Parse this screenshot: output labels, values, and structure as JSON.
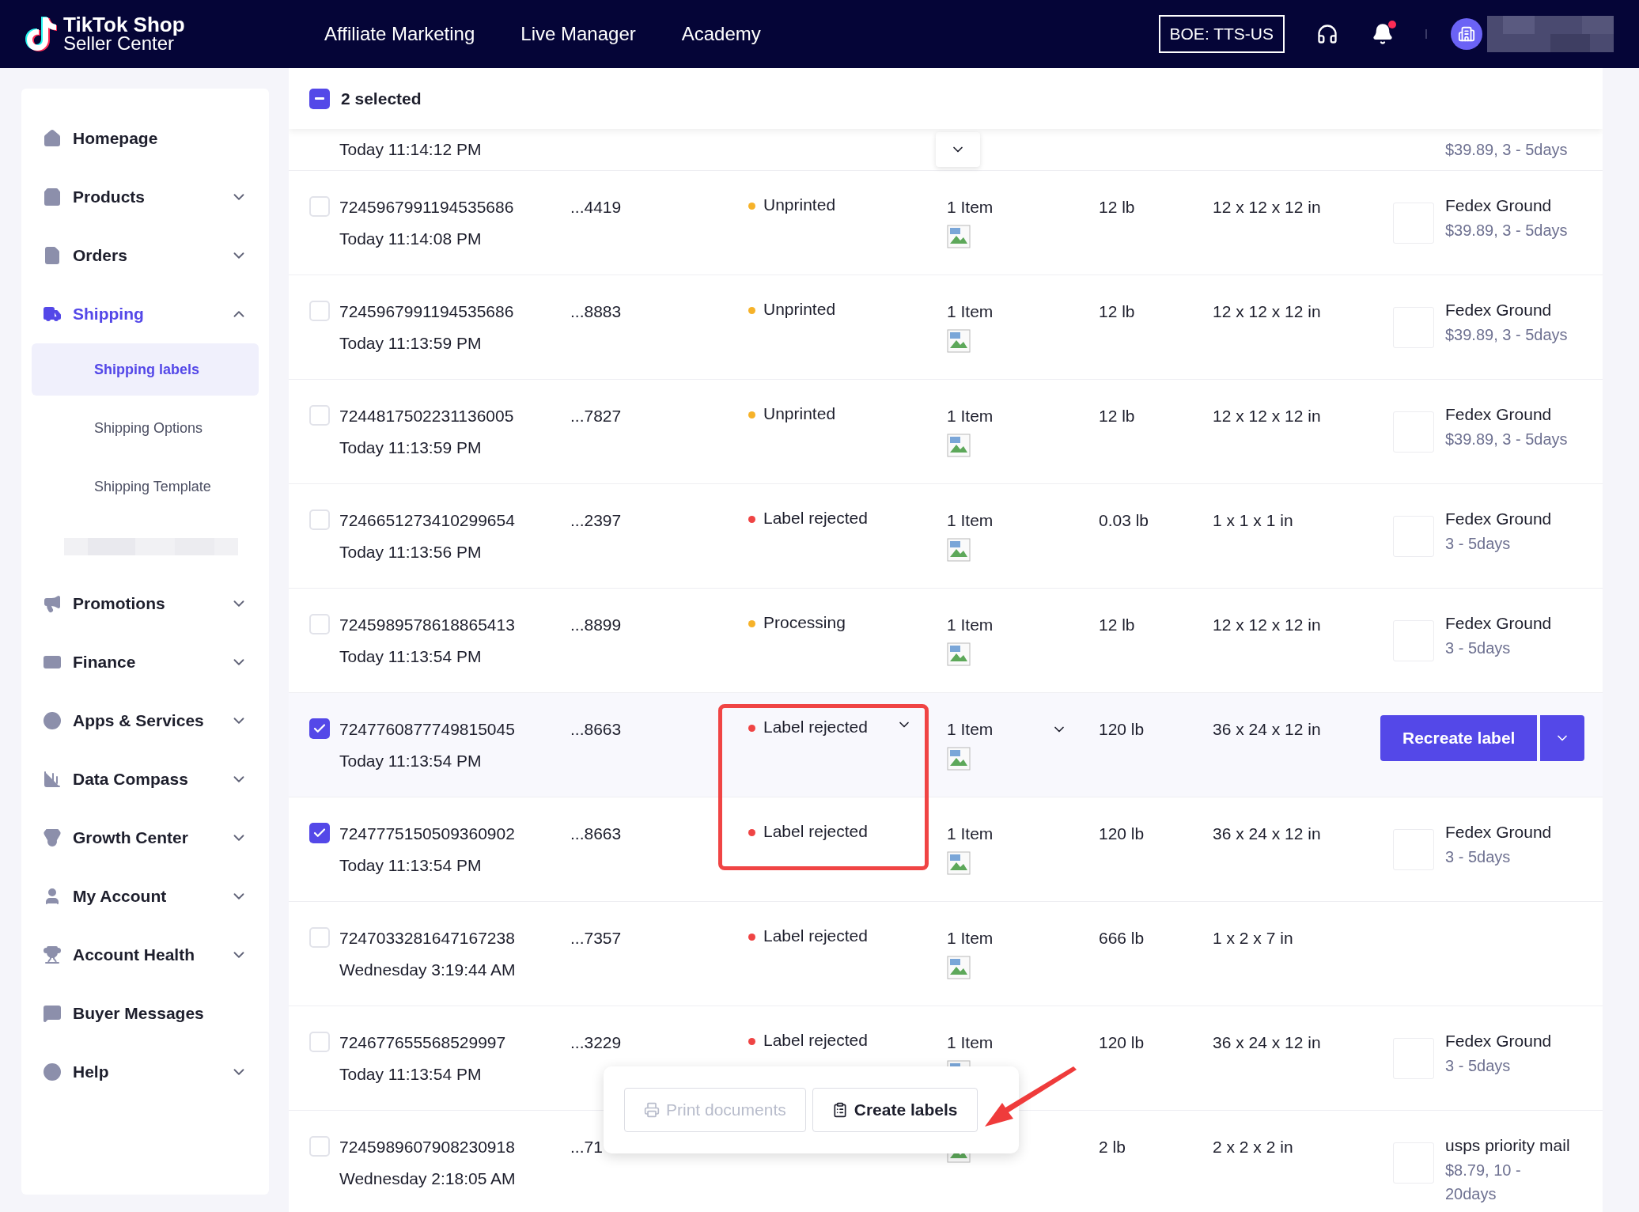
{
  "header": {
    "logo_title": "TikTok Shop",
    "logo_subtitle": "Seller Center",
    "nav": [
      "Affiliate Marketing",
      "Live Manager",
      "Academy"
    ],
    "env_badge": "BOE: TTS-US",
    "notifications_unread": true
  },
  "sidebar": {
    "items": [
      {
        "label": "Homepage",
        "kind": "link",
        "selected": false
      },
      {
        "label": "Products",
        "kind": "group",
        "expanded": false,
        "selected": false
      },
      {
        "label": "Orders",
        "kind": "group",
        "expanded": false,
        "selected": false
      },
      {
        "label": "Shipping",
        "kind": "group",
        "expanded": true,
        "selected": true,
        "children": [
          {
            "label": "Shipping labels",
            "selected": true
          },
          {
            "label": "Shipping Options",
            "selected": false
          },
          {
            "label": "Shipping Template",
            "selected": false
          },
          {
            "kind": "redacted"
          }
        ]
      },
      {
        "label": "Promotions",
        "kind": "group",
        "expanded": false,
        "selected": false
      },
      {
        "label": "Finance",
        "kind": "group",
        "expanded": false,
        "selected": false
      },
      {
        "label": "Apps & Services",
        "kind": "group",
        "expanded": false,
        "selected": false
      },
      {
        "label": "Data Compass",
        "kind": "group",
        "expanded": false,
        "selected": false
      },
      {
        "label": "Growth Center",
        "kind": "group",
        "expanded": false,
        "selected": false
      },
      {
        "label": "My Account",
        "kind": "group",
        "expanded": false,
        "selected": false
      },
      {
        "label": "Account Health",
        "kind": "group",
        "expanded": false,
        "selected": false
      },
      {
        "label": "Buyer Messages",
        "kind": "link",
        "selected": false
      },
      {
        "label": "Help",
        "kind": "group",
        "expanded": false,
        "selected": false
      }
    ]
  },
  "selection_bar": {
    "label": "2 selected",
    "indeterminate": true
  },
  "partial_row": {
    "time": "Today 11:14:12 PM",
    "carrier_detail": "$39.89, 3 - 5days"
  },
  "rows": [
    {
      "order_id": "7245967991194535686",
      "time": "Today 11:14:08 PM",
      "suffix": "...4419",
      "status": "Unprinted",
      "color": "#f6b229",
      "items": "1 Item",
      "weight": "12 lb",
      "dimensions": "12 x 12 x 12 in",
      "kind": "carrier",
      "carrier": "Fedex Ground",
      "carrier_detail": "$39.89, 3 - 5days",
      "checked": false,
      "highlighted": false
    },
    {
      "order_id": "7245967991194535686",
      "time": "Today 11:13:59 PM",
      "suffix": "...8883",
      "status": "Unprinted",
      "color": "#f6b229",
      "items": "1 Item",
      "weight": "12 lb",
      "dimensions": "12 x 12 x 12 in",
      "kind": "carrier",
      "carrier": "Fedex Ground",
      "carrier_detail": "$39.89, 3 - 5days",
      "checked": false,
      "highlighted": false
    },
    {
      "order_id": "7244817502231136005",
      "time": "Today 11:13:59 PM",
      "suffix": "...7827",
      "status": "Unprinted",
      "color": "#f6b229",
      "items": "1 Item",
      "weight": "12 lb",
      "dimensions": "12 x 12 x 12 in",
      "kind": "carrier",
      "carrier": "Fedex Ground",
      "carrier_detail": "$39.89, 3 - 5days",
      "checked": false,
      "highlighted": false
    },
    {
      "order_id": "7246651273410299654",
      "time": "Today 11:13:56 PM",
      "suffix": "...2397",
      "status": "Label rejected",
      "color": "#ef4444",
      "items": "1 Item",
      "weight": "0.03 lb",
      "dimensions": "1 x 1 x 1 in",
      "kind": "carrier",
      "carrier": "Fedex Ground",
      "carrier_detail": "3 - 5days",
      "checked": false,
      "highlighted": false
    },
    {
      "order_id": "7245989578618865413",
      "time": "Today 11:13:54 PM",
      "suffix": "...8899",
      "status": "Processing",
      "color": "#f6b229",
      "items": "1 Item",
      "weight": "12 lb",
      "dimensions": "12 x 12 x 12 in",
      "kind": "carrier",
      "carrier": "Fedex Ground",
      "carrier_detail": "3 - 5days",
      "checked": false,
      "highlighted": false
    },
    {
      "order_id": "7247760877749815045",
      "time": "Today 11:13:54 PM",
      "suffix": "...8663",
      "status": "Label rejected",
      "color": "#ef4444",
      "items": "1 Item",
      "weight": "120 lb",
      "dimensions": "36 x 24 x 12 in",
      "kind": "action",
      "action": "Recreate label",
      "checked": true,
      "highlighted": true
    },
    {
      "order_id": "7247775150509360902",
      "time": "Today 11:13:54 PM",
      "suffix": "...8663",
      "status": "Label rejected",
      "color": "#ef4444",
      "items": "1 Item",
      "weight": "120 lb",
      "dimensions": "36 x 24 x 12 in",
      "kind": "carrier",
      "carrier": "Fedex Ground",
      "carrier_detail": "3 - 5days",
      "checked": true,
      "highlighted": false
    },
    {
      "order_id": "7247033281647167238",
      "time": "Wednesday 3:19:44 AM",
      "suffix": "...7357",
      "status": "Label rejected",
      "color": "#ef4444",
      "items": "1 Item",
      "weight": "666 lb",
      "dimensions": "1 x 2 x 7 in",
      "kind": "none",
      "checked": false,
      "highlighted": false
    },
    {
      "order_id": "724677655568529997",
      "time": "Today 11:13:54 PM",
      "suffix": "...3229",
      "status": "Label rejected",
      "color": "#ef4444",
      "items": "1 Item",
      "weight": "120 lb",
      "dimensions": "36 x 24 x 12 in",
      "kind": "carrier",
      "carrier": "Fedex Ground",
      "carrier_detail": "3 - 5days",
      "checked": false,
      "highlighted": false
    },
    {
      "order_id": "7245989607908230918",
      "time": "Wednesday 2:18:05 AM",
      "suffix": "...71",
      "weight": "2 lb",
      "dimensions": "2 x 2 x 2 in",
      "kind": "carrier",
      "carrier": "usps priority mail",
      "carrier_detail": "$8.79, 10 - 20days",
      "checked": false,
      "highlighted": false
    }
  ],
  "bulk_actions": [
    {
      "label": "Print documents",
      "disabled": true
    },
    {
      "label": "Create labels",
      "disabled": false
    }
  ]
}
